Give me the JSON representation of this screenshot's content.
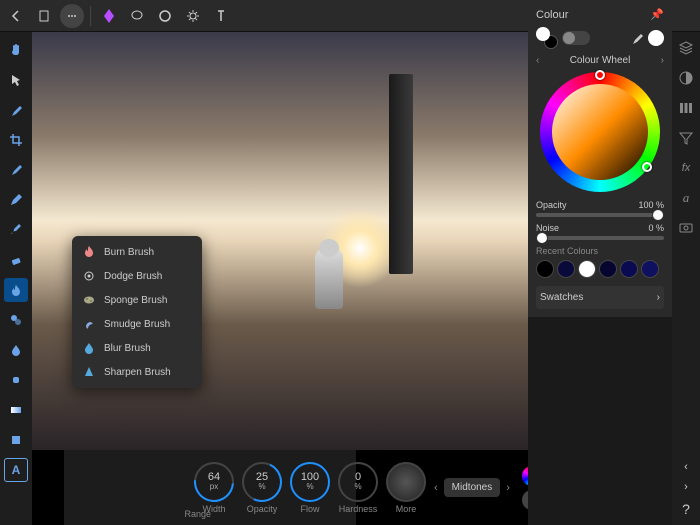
{
  "top": {
    "icons": [
      "back",
      "document",
      "more",
      "persona",
      "lasso",
      "circle",
      "gear",
      "text"
    ]
  },
  "tools": [
    "hand",
    "pointer",
    "eyedropper",
    "crop",
    "paintbrush",
    "pencil",
    "brush2",
    "eraser",
    "flame",
    "clone",
    "droplet",
    "heal",
    "gradient",
    "shape",
    "text-tool"
  ],
  "brush_popup": [
    {
      "label": "Burn Brush",
      "icon": "flame"
    },
    {
      "label": "Dodge Brush",
      "icon": "dodge"
    },
    {
      "label": "Sponge Brush",
      "icon": "sponge"
    },
    {
      "label": "Smudge Brush",
      "icon": "smudge"
    },
    {
      "label": "Blur Brush",
      "icon": "blur"
    },
    {
      "label": "Sharpen Brush",
      "icon": "sharpen"
    }
  ],
  "bottom": {
    "dials": [
      {
        "value": "64",
        "unit": "px",
        "label": "Width",
        "pct": 40
      },
      {
        "value": "25",
        "unit": "%",
        "label": "Opacity",
        "pct": 25
      },
      {
        "value": "100",
        "unit": "%",
        "label": "Flow",
        "pct": 100,
        "active": true
      },
      {
        "value": "0",
        "unit": "%",
        "label": "Hardness",
        "pct": 0
      }
    ],
    "more": "More",
    "range_label": "Midtones",
    "range_title": "Range"
  },
  "colour": {
    "title": "Colour",
    "primary": "#ffffff",
    "secondary": "#000000",
    "mode_label": "Colour Wheel",
    "opacity_label": "Opacity",
    "opacity_value": "100 %",
    "noise_label": "Noise",
    "noise_value": "0 %",
    "recent_label": "Recent Colours",
    "recent": [
      "#000000",
      "#0a0a3a",
      "#ffffff",
      "#050530",
      "#0a0a50",
      "#101060"
    ],
    "swatches_label": "Swatches"
  },
  "right_rail": [
    "layers",
    "adjustments",
    "channels",
    "filters",
    "fx",
    "text",
    "camera"
  ]
}
